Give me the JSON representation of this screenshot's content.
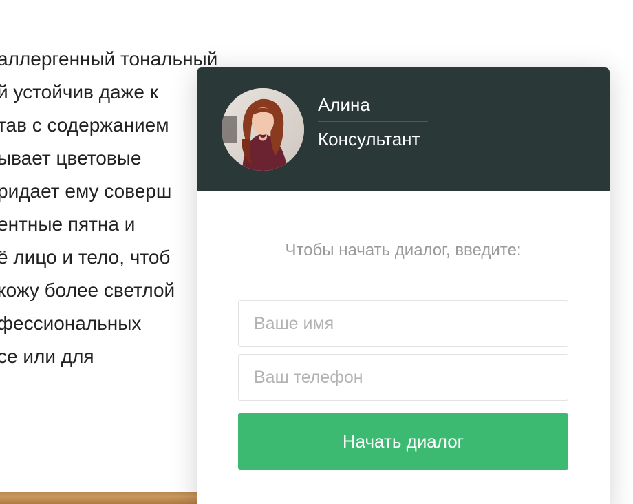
{
  "article": {
    "lines": [
      "аллергенный тональный",
      "й устойчив даже к",
      "тав с содержанием",
      "ывает цветовые",
      "ридает ему соверш",
      "ентные пятна и",
      "ё лицо и тело, чтоб",
      "кожу более светлой",
      "фессиональных",
      "се или для"
    ]
  },
  "widget": {
    "consultant": {
      "name": "Алина",
      "role": "Консультант"
    },
    "prompt": "Чтобы начать диалог, введите:",
    "name_field": {
      "value": "",
      "placeholder": "Ваше имя"
    },
    "phone_field": {
      "value": "",
      "placeholder": "Ваш телефон"
    },
    "start_button_label": "Начать диалог",
    "colors": {
      "header_bg": "#2a3838",
      "button_bg": "#3dba72"
    }
  }
}
